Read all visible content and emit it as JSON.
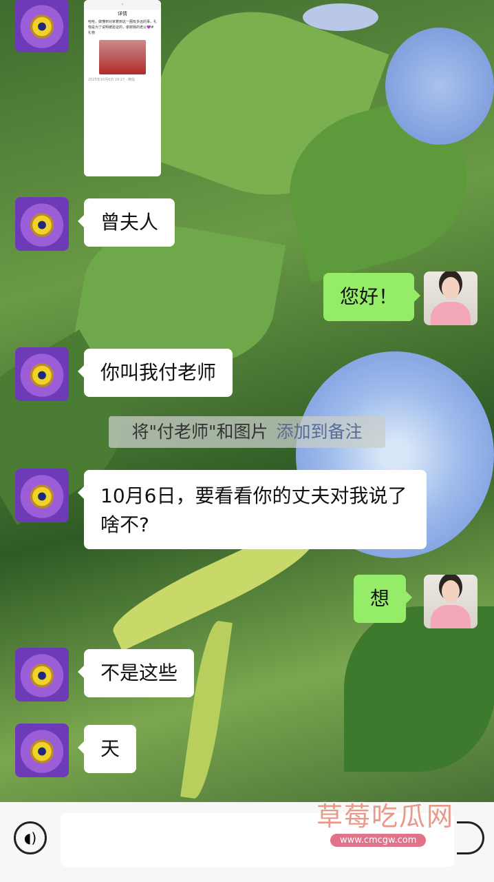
{
  "colors": {
    "my_bubble": "#95ec69",
    "their_bubble": "#ffffff",
    "notice_link": "#576b95"
  },
  "screenshot": {
    "title": "详情",
    "text": "哈哈，做懂到对家着到这一圈有多远的事，礼物是为了说明被验证的，谢谢我的老公💜#礼物",
    "date": "2025年10月6日 10:27 · 微信"
  },
  "messages": [
    {
      "sender": "them",
      "text": "曾夫人"
    },
    {
      "sender": "me",
      "text": "您好！"
    },
    {
      "sender": "them",
      "text": "你叫我付老师"
    },
    {
      "sender": "them",
      "text": "10月6日，要看看你的丈夫对我说了啥不?"
    },
    {
      "sender": "me",
      "text": "想"
    },
    {
      "sender": "them",
      "text": "不是这些"
    },
    {
      "sender": "them",
      "text": "天"
    }
  ],
  "notice": {
    "text": "将\"付老师\"和图片",
    "link": "添加到备注"
  },
  "input": {
    "voice_icon": "voice-icon",
    "value": ""
  },
  "watermark": {
    "line1": "草莓吃瓜网",
    "line2": "www.cmcgw.com"
  }
}
